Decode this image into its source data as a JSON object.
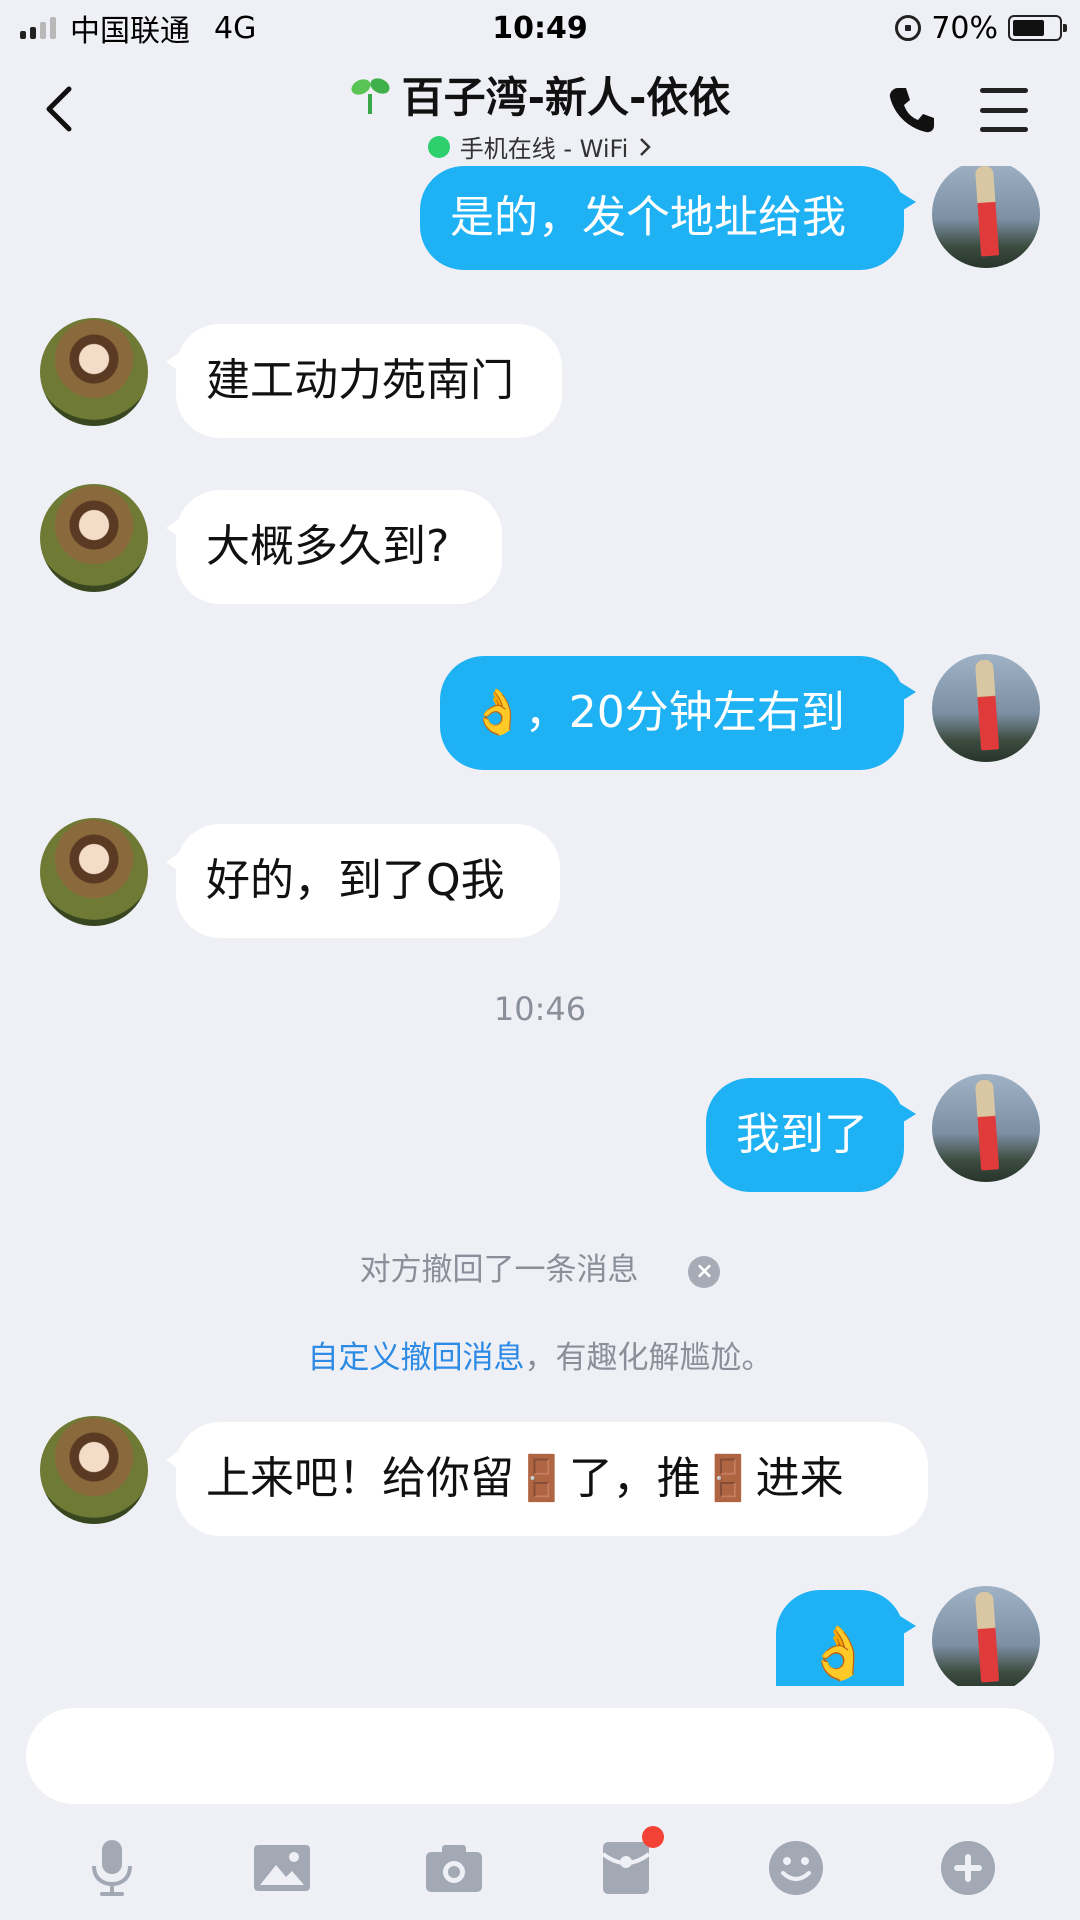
{
  "status_bar": {
    "carrier": "中国联通",
    "network": "4G",
    "time": "10:49",
    "battery": "70%",
    "battery_level": 0.7
  },
  "header": {
    "title": "百子湾-新人-依依",
    "presence": "手机在线 - WiFi",
    "presence_color": "#2ed06e"
  },
  "messages": [
    {
      "side": "out",
      "text": "是的，发个地址给我"
    },
    {
      "side": "in",
      "text": "建工动力苑南门"
    },
    {
      "side": "in",
      "text": "大概多久到?"
    },
    {
      "side": "out",
      "emoji": "👌",
      "text": "，20分钟左右到"
    },
    {
      "side": "in",
      "text": "好的，到了Q我"
    },
    {
      "side": "out",
      "text": "我到了"
    },
    {
      "side": "in",
      "part1": "上来吧！给你留",
      "emoji": "🚪",
      "part2": "了，推",
      "part3": "进来"
    },
    {
      "side": "out",
      "emoji": "👌"
    }
  ],
  "timestamp": "10:46",
  "system": {
    "recalled": "对方撤回了一条消息",
    "custom_link": "自定义撤回消息",
    "custom_rest": "，有趣化解尴尬。"
  },
  "colors": {
    "out_bubble": "#1eb1f3",
    "in_bubble": "#ffffff",
    "background": "#eef0f6",
    "link": "#2d8ae5"
  },
  "toolbar_icons": [
    "microphone-icon",
    "image-icon",
    "camera-icon",
    "red-packet-icon",
    "emoji-icon",
    "plus-icon"
  ]
}
